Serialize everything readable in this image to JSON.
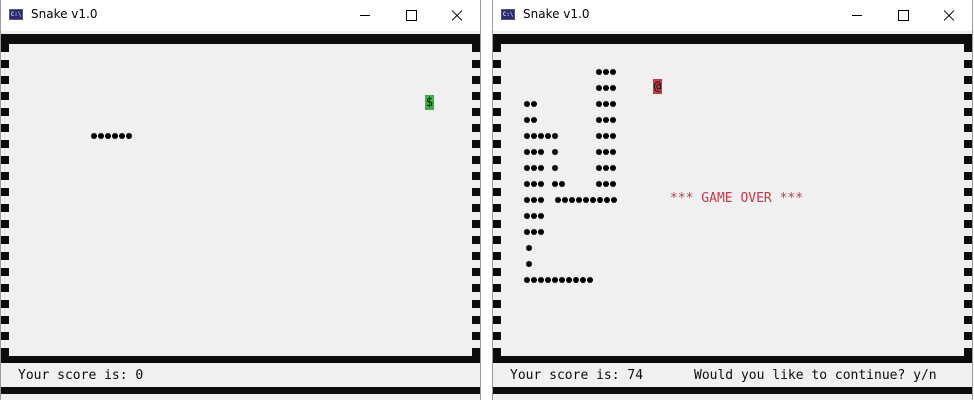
{
  "windows": [
    {
      "title": "Snake v1.0",
      "icon": "console-app-icon",
      "icon_text": "C:\\",
      "score_text": "Your score is: 0",
      "food": {
        "char": "$",
        "color": "#3cb043"
      },
      "snake_color": "#000000",
      "game_over_text": "",
      "prompt_text": ""
    },
    {
      "title": "Snake v1.0",
      "icon": "console-app-icon",
      "icon_text": "C:\\",
      "score_text": "Your score is: 74",
      "food": {
        "char": "@",
        "color": "#c5384a"
      },
      "snake_color": "#000000",
      "game_over_text": "*** GAME OVER ***",
      "prompt_text": "Would you like to continue? y/n"
    }
  ],
  "colors": {
    "board_bg": "#f0f0f0",
    "wall": "#0c0c0c",
    "game_over": "#c5384a"
  }
}
